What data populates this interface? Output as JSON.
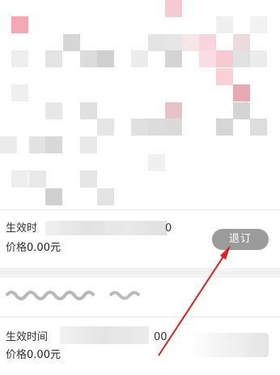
{
  "rows": [
    {
      "label": "生效时",
      "label_suffix": "0",
      "price_label": "价格",
      "price_value": "0.00元",
      "action_label": "退订"
    },
    {
      "label": "生效时间",
      "label_suffix": "00",
      "price_label": "价格",
      "price_value": "0.00元"
    }
  ],
  "colors": {
    "button_bg": "#9b9b9b",
    "arrow": "#e02020",
    "separator": "#f2f2f2"
  }
}
